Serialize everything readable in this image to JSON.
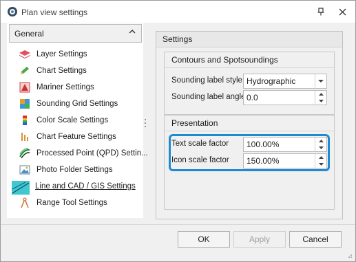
{
  "window": {
    "title": "Plan view settings"
  },
  "sidebar": {
    "group_label": "General",
    "items": [
      {
        "label": "Layer Settings",
        "icon": "layers-icon"
      },
      {
        "label": "Chart Settings",
        "icon": "chart-pen-icon"
      },
      {
        "label": "Mariner Settings",
        "icon": "mariner-icon"
      },
      {
        "label": "Sounding Grid Settings",
        "icon": "sounding-grid-icon"
      },
      {
        "label": "Color Scale Settings",
        "icon": "color-scale-icon"
      },
      {
        "label": "Chart Feature Settings",
        "icon": "chart-feature-icon"
      },
      {
        "label": "Processed Point (QPD) Settin...",
        "icon": "processed-point-icon"
      },
      {
        "label": "Photo Folder Settings",
        "icon": "photo-folder-icon"
      },
      {
        "label": "Line and CAD / GIS Settings",
        "icon": "line-cad-icon",
        "selected": true
      },
      {
        "label": "Range Tool Settings",
        "icon": "range-tool-icon"
      }
    ]
  },
  "settings": {
    "title": "Settings",
    "contours": {
      "title": "Contours and Spotsoundings",
      "label_style_label": "Sounding label style",
      "label_style_value": "Hydrographic",
      "label_angle_label": "Sounding label angle",
      "label_angle_value": "0.0"
    },
    "presentation": {
      "title": "Presentation",
      "text_scale_label": "Text scale factor",
      "text_scale_value": "100.00%",
      "icon_scale_label": "Icon scale factor",
      "icon_scale_value": "150.00%"
    }
  },
  "buttons": {
    "ok": "OK",
    "apply": "Apply",
    "cancel": "Cancel"
  },
  "colors": {
    "highlight": "#1f8ad0",
    "selected_item": "#ffffff"
  }
}
